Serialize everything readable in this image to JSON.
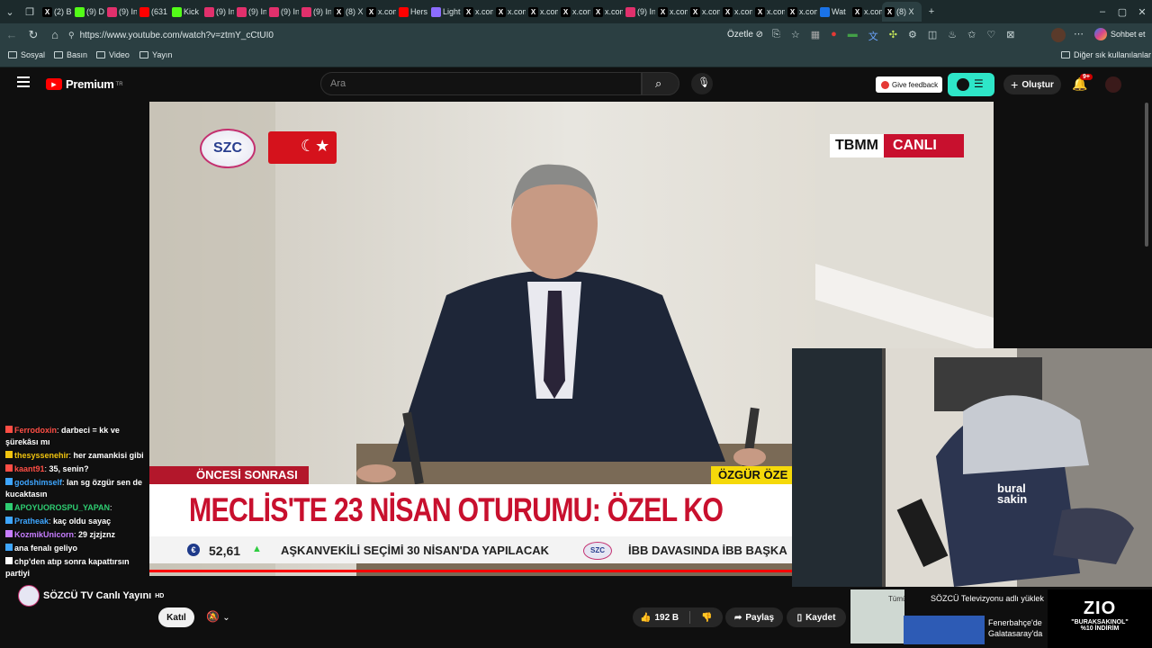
{
  "browser": {
    "tabs": [
      {
        "label": "(2) B",
        "icon": "x-icon",
        "color": "#000000"
      },
      {
        "label": "(9) D",
        "icon": "kick-icon",
        "color": "#53fc18"
      },
      {
        "label": "(9) In",
        "icon": "instagram-icon",
        "color": "#e1306c"
      },
      {
        "label": "(631",
        "icon": "youtube-icon",
        "color": "#ff0000"
      },
      {
        "label": "Kick",
        "icon": "kick-icon",
        "color": "#53fc18"
      },
      {
        "label": "(9) In",
        "icon": "instagram-icon",
        "color": "#e1306c"
      },
      {
        "label": "(9) In",
        "icon": "instagram-icon",
        "color": "#e1306c"
      },
      {
        "label": "(9) In",
        "icon": "instagram-icon",
        "color": "#e1306c"
      },
      {
        "label": "(9) In",
        "icon": "instagram-icon",
        "color": "#e1306c"
      },
      {
        "label": "(8) X",
        "icon": "x-icon",
        "color": "#000000"
      },
      {
        "label": "x.com",
        "icon": "x-icon",
        "color": "#000000"
      },
      {
        "label": "Hers",
        "icon": "youtube-icon",
        "color": "#ff0000"
      },
      {
        "label": "Light",
        "icon": "pen-icon",
        "color": "#8c6cff"
      },
      {
        "label": "x.com",
        "icon": "x-icon",
        "color": "#000000"
      },
      {
        "label": "x.com",
        "icon": "x-icon",
        "color": "#000000"
      },
      {
        "label": "x.com",
        "icon": "x-icon",
        "color": "#000000"
      },
      {
        "label": "x.com",
        "icon": "x-icon",
        "color": "#000000"
      },
      {
        "label": "x.com",
        "icon": "x-icon",
        "color": "#000000"
      },
      {
        "label": "(9) In",
        "icon": "instagram-icon",
        "color": "#e1306c"
      },
      {
        "label": "x.com",
        "icon": "x-icon",
        "color": "#000000"
      },
      {
        "label": "x.com",
        "icon": "x-icon",
        "color": "#000000"
      },
      {
        "label": "x.com",
        "icon": "x-icon",
        "color": "#000000"
      },
      {
        "label": "x.com",
        "icon": "x-icon",
        "color": "#000000"
      },
      {
        "label": "x.com",
        "icon": "x-icon",
        "color": "#000000"
      },
      {
        "label": "Wat",
        "icon": "globe-icon",
        "color": "#1a73e8"
      },
      {
        "label": "x.com",
        "icon": "x-icon",
        "color": "#000000"
      },
      {
        "label": "(8) X",
        "icon": "x-icon",
        "color": "#000000"
      }
    ],
    "url": "https://www.youtube.com/watch?v=ztmY_cCtUI0",
    "summarize_label": "Özetle",
    "copilot_label": "Sohbet et",
    "bookmarks": [
      "Sosyal",
      "Basın",
      "Video",
      "Yayın"
    ],
    "other_bookmarks": "Diğer sık kullanılanlar"
  },
  "youtube": {
    "logo_text": "Premium",
    "region": "TR",
    "search_placeholder": "Ara",
    "feedback_label": "Give feedback",
    "create_label": "Oluştur",
    "notif_badge": "9+",
    "join_label": "Katıl",
    "likes": "192 B",
    "share_label": "Paylaş",
    "save_label": "Kaydet",
    "channel_name": "SÖZCÜ TV Canlı Yayını",
    "channel_badge": "HD"
  },
  "broadcast": {
    "channel_logo": "SZC",
    "tbmm_label": "TBMM",
    "live_label": "CANLI",
    "segment_label": "ÖNCESİ SONRASI",
    "speaker_label": "ÖZGÜR ÖZE",
    "headline": "MECLİS'TE 23 NİSAN OTURUMU: ÖZEL KO",
    "ticker_value": "52,61",
    "ticker_text_1": "AŞKANVEKİLİ SEÇİMİ 30 NİSAN'DA YAPILACAK",
    "ticker_text_2": "İBB DAVASINDA İBB BAŞKA"
  },
  "chat": [
    {
      "name": "Ferrodoxin",
      "text": "darbeci = kk ve şürekâsı mı",
      "color": "#ff4e45"
    },
    {
      "name": "thesyssenehir",
      "text": "her zamankisi gibi",
      "color": "#f1c40f"
    },
    {
      "name": "kaant91",
      "text": "35, senin?",
      "color": "#ff4e45"
    },
    {
      "name": "godshimself",
      "text": "lan sg özgür sen de kucaktasın",
      "color": "#3ea6ff"
    },
    {
      "name": "APOYUOROSPU_YAPAN",
      "text": "",
      "color": "#2ecc71"
    },
    {
      "name": "Pratheak",
      "text": "kaç oldu sayaç",
      "color": "#3ea6ff"
    },
    {
      "name": "KozmikUnicorn",
      "text": "29 zjzjznz",
      "color": "#c77dff"
    },
    {
      "name": "",
      "text": "ana fenalı geliyo",
      "color": "#3ea6ff"
    },
    {
      "name": "",
      "text": "chp'den atıp sonra kapattırsın partiyi",
      "color": "#ffffff"
    }
  ],
  "webcam": {
    "chair_brand": "bural sakin"
  },
  "promos": [
    {
      "tag": "Tümü",
      "text": "SÖZCÜ Televizyonu adlı yüklek"
    },
    {
      "tag": "",
      "text": "Fenerbahçe'de Galatasaray'da"
    }
  ],
  "sponsor": {
    "logo": "ZIO",
    "code": "\"BURAKSAKINOL\"",
    "discount": "%10 İNDİRİM"
  }
}
